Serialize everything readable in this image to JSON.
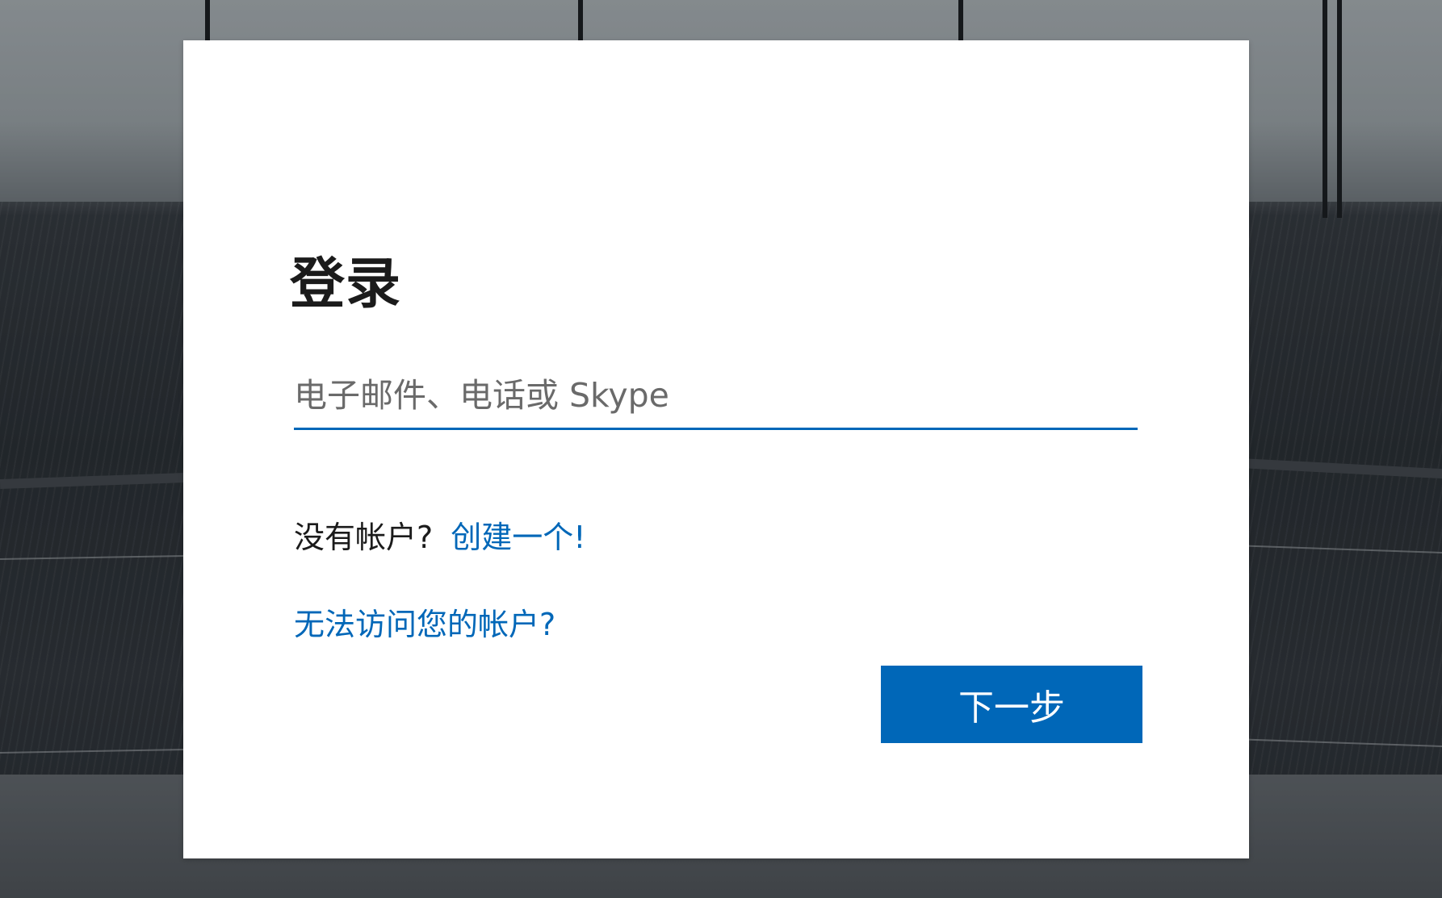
{
  "signin": {
    "title": "登录",
    "identifier": {
      "value": "",
      "placeholder": "电子邮件、电话或 Skype"
    },
    "no_account_text": "没有帐户?",
    "create_account_link": "创建一个!",
    "cant_access_link": "无法访问您的帐户?",
    "next_button": "下一步"
  },
  "colors": {
    "accent": "#0067b8",
    "text": "#1b1b1b",
    "placeholder": "#6a6a6a",
    "card_background": "#ffffff"
  }
}
